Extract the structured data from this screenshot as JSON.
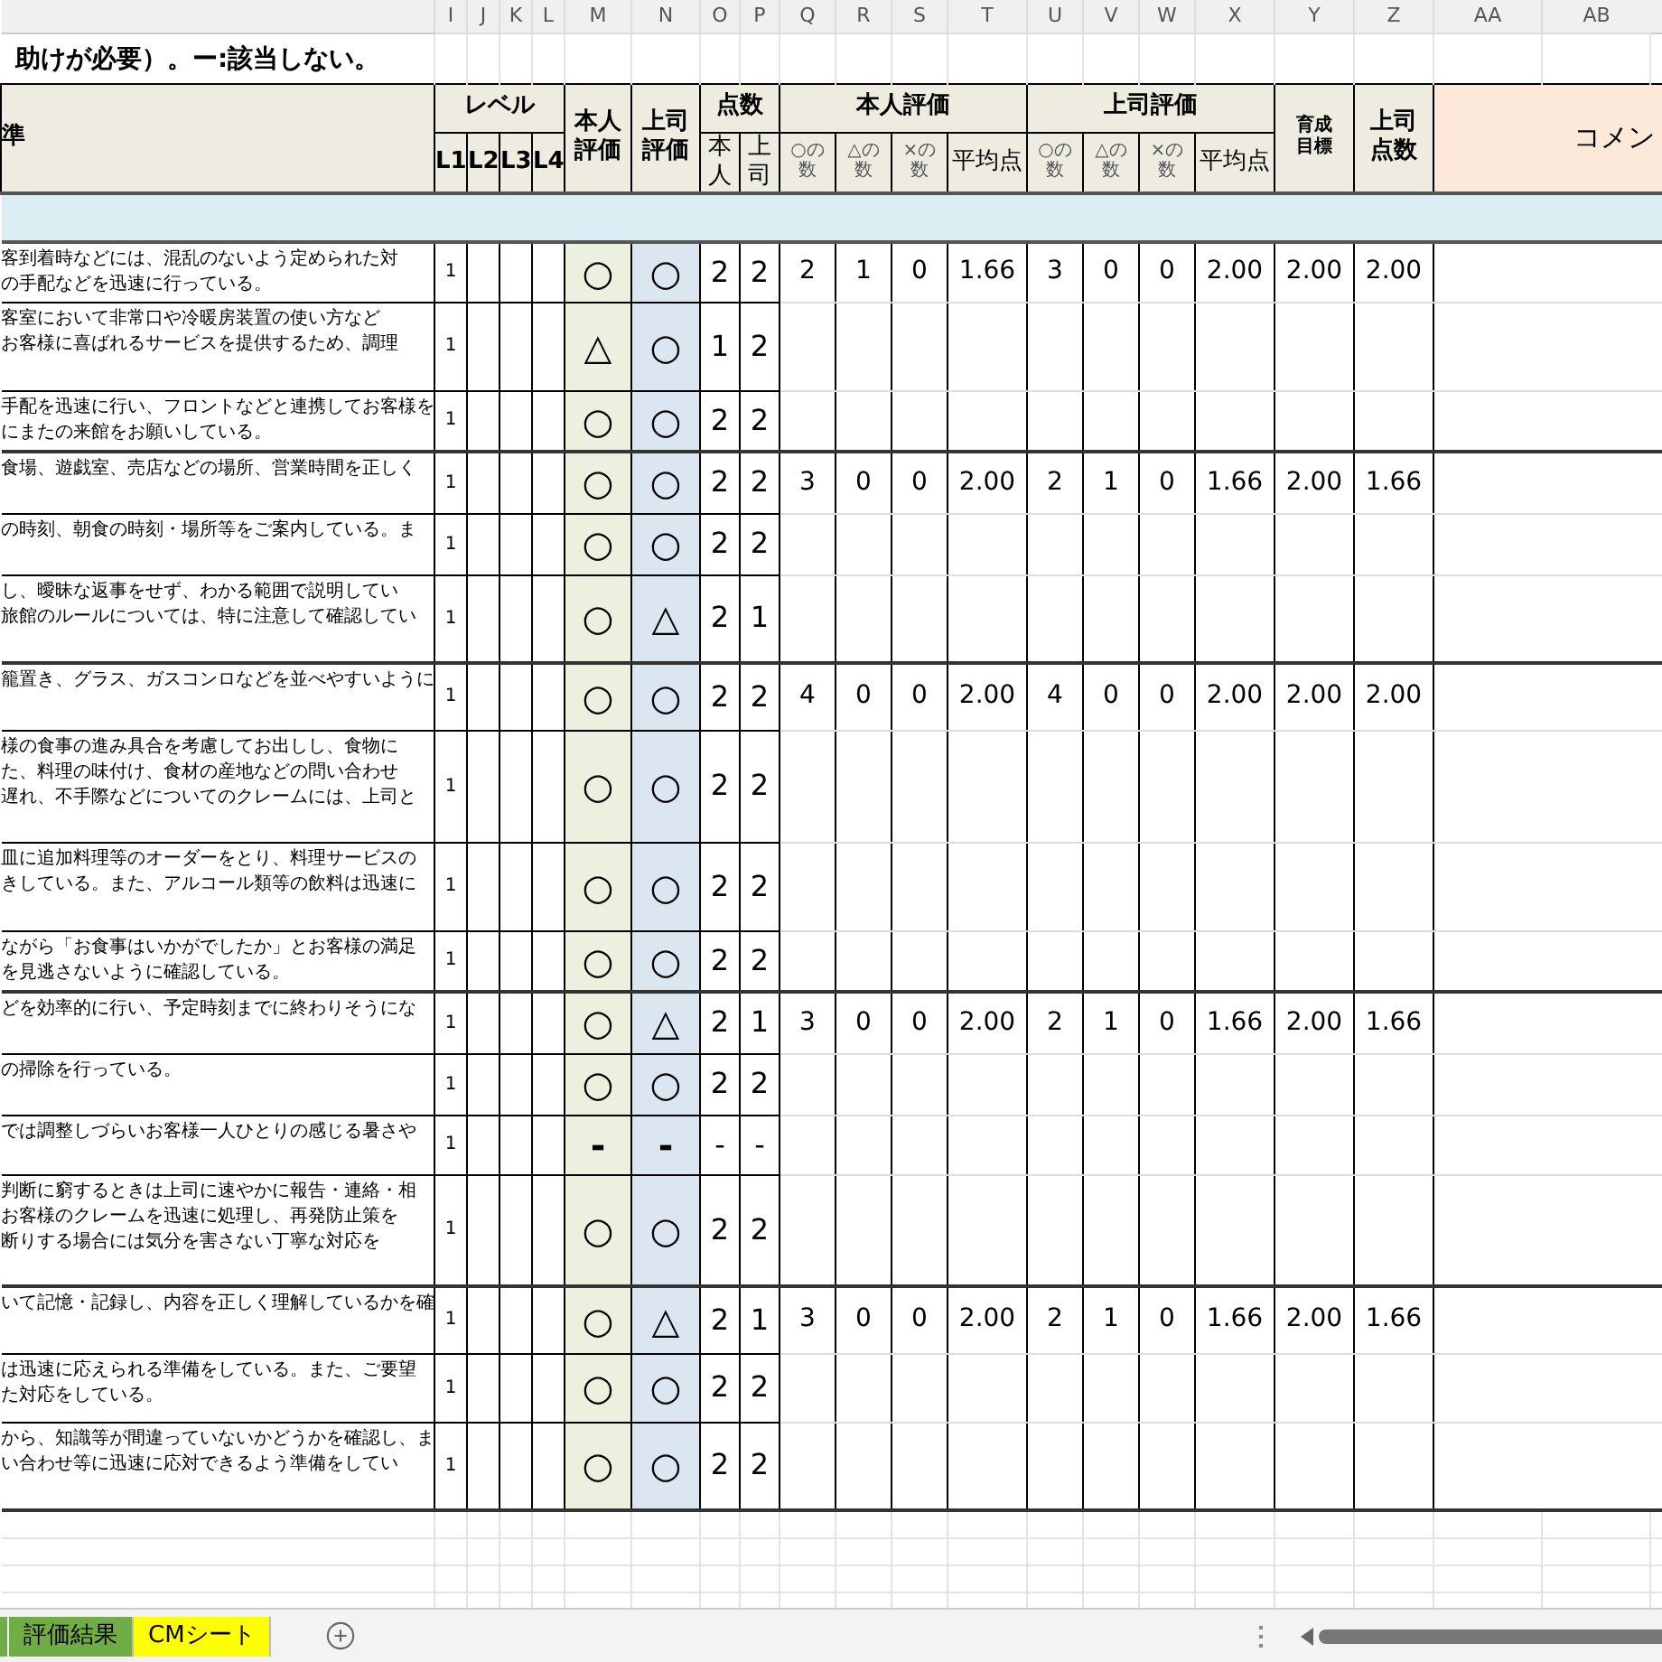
{
  "column_letters": [
    "I",
    "J",
    "K",
    "L",
    "M",
    "N",
    "O",
    "P",
    "Q",
    "R",
    "S",
    "T",
    "U",
    "V",
    "W",
    "X",
    "Y",
    "Z",
    "AA",
    "AB"
  ],
  "title": "助けが必要）。ー:該当しない。",
  "header": {
    "criteria": "準",
    "level": "レベル",
    "levels": [
      "L1",
      "L2",
      "L3",
      "L4"
    ],
    "self_eval": [
      "本人",
      "評価"
    ],
    "boss_eval": [
      "上司",
      "評価"
    ],
    "score": "点数",
    "score_self": [
      "本",
      "人"
    ],
    "score_boss": [
      "上",
      "司"
    ],
    "self_group": "本人評価",
    "boss_group": "上司評価",
    "counts_self": [
      "○の数",
      "△の数",
      "×の数",
      "平均点"
    ],
    "counts_boss": [
      "○の数",
      "△の数",
      "×の数",
      "平均点"
    ],
    "target": "育成目標",
    "boss_score": [
      "上司",
      "点数"
    ],
    "comment": "コメン"
  },
  "groups": [
    {
      "summary": [
        "2",
        "1",
        "0",
        "1.66",
        "3",
        "0",
        "0",
        "2.00",
        "2.00",
        "2.00"
      ],
      "rows": [
        {
          "lines": [
            "客到着時などには、混乱のないよう定められた対",
            "の手配などを迅速に行っている。"
          ],
          "l1": "1",
          "self": "○",
          "boss": "○",
          "score_self": "2",
          "score_boss": "2"
        },
        {
          "lines": [
            "客室において非常口や冷暖房装置の使い方など",
            "お客様に喜ばれるサービスを提供するため、調理"
          ],
          "l1": "1",
          "self": "△",
          "boss": "○",
          "score_self": "1",
          "score_boss": "2"
        },
        {
          "lines": [
            "手配を迅速に行い、フロントなどと連携してお客様を",
            "にまたの来館をお願いしている。"
          ],
          "l1": "1",
          "self": "○",
          "boss": "○",
          "score_self": "2",
          "score_boss": "2"
        }
      ]
    },
    {
      "summary": [
        "3",
        "0",
        "0",
        "2.00",
        "2",
        "1",
        "0",
        "1.66",
        "2.00",
        "1.66"
      ],
      "rows": [
        {
          "lines": [
            "食場、遊戯室、売店などの場所、営業時間を正しく"
          ],
          "l1": "1",
          "self": "○",
          "boss": "○",
          "score_self": "2",
          "score_boss": "2"
        },
        {
          "lines": [
            "の時刻、朝食の時刻・場所等をご案内している。ま"
          ],
          "l1": "1",
          "self": "○",
          "boss": "○",
          "score_self": "2",
          "score_boss": "2"
        },
        {
          "lines": [
            "し、曖昧な返事をせず、わかる範囲で説明してい",
            "旅館のルールについては、特に注意して確認してい"
          ],
          "l1": "1",
          "self": "○",
          "boss": "△",
          "score_self": "2",
          "score_boss": "1"
        }
      ]
    },
    {
      "summary": [
        "4",
        "0",
        "0",
        "2.00",
        "4",
        "0",
        "0",
        "2.00",
        "2.00",
        "2.00"
      ],
      "rows": [
        {
          "lines": [
            "籠置き、グラス、ガスコンロなどを並べやすいように"
          ],
          "l1": "1",
          "self": "○",
          "boss": "○",
          "score_self": "2",
          "score_boss": "2"
        },
        {
          "lines": [
            "様の食事の進み具合を考慮してお出しし、食物に",
            "た、料理の味付け、食材の産地などの問い合わせ",
            "遅れ、不手際などについてのクレームには、上司と"
          ],
          "l1": "1",
          "self": "○",
          "boss": "○",
          "score_self": "2",
          "score_boss": "2"
        },
        {
          "lines": [
            "皿に追加料理等のオーダーをとり、料理サービスの",
            "きしている。また、アルコール類等の飲料は迅速に"
          ],
          "l1": "1",
          "self": "○",
          "boss": "○",
          "score_self": "2",
          "score_boss": "2"
        },
        {
          "lines": [
            "ながら「お食事はいかがでしたか」とお客様の満足",
            "を見逃さないように確認している。"
          ],
          "l1": "1",
          "self": "○",
          "boss": "○",
          "score_self": "2",
          "score_boss": "2"
        }
      ]
    },
    {
      "summary": [
        "3",
        "0",
        "0",
        "2.00",
        "2",
        "1",
        "0",
        "1.66",
        "2.00",
        "1.66"
      ],
      "rows": [
        {
          "lines": [
            "どを効率的に行い、予定時刻までに終わりそうにな"
          ],
          "l1": "1",
          "self": "○",
          "boss": "△",
          "score_self": "2",
          "score_boss": "1"
        },
        {
          "lines": [
            "の掃除を行っている。"
          ],
          "l1": "1",
          "self": "○",
          "boss": "○",
          "score_self": "2",
          "score_boss": "2"
        },
        {
          "lines": [
            "では調整しづらいお客様一人ひとりの感じる暑さや"
          ],
          "l1": "1",
          "self": "-",
          "boss": "-",
          "score_self": "-",
          "score_boss": "-"
        },
        {
          "lines": [
            "判断に窮するときは上司に速やかに報告・連絡・相",
            "お客様のクレームを迅速に処理し、再発防止策を",
            "断りする場合には気分を害さない丁寧な対応を"
          ],
          "l1": "1",
          "self": "○",
          "boss": "○",
          "score_self": "2",
          "score_boss": "2"
        }
      ]
    },
    {
      "summary": [
        "3",
        "0",
        "0",
        "2.00",
        "2",
        "1",
        "0",
        "1.66",
        "2.00",
        "1.66"
      ],
      "rows": [
        {
          "lines": [
            "いて記憶・記録し、内容を正しく理解しているかを確"
          ],
          "l1": "1",
          "self": "○",
          "boss": "△",
          "score_self": "2",
          "score_boss": "1"
        },
        {
          "lines": [
            "は迅速に応えられる準備をしている。また、ご要望",
            "た対応をしている。"
          ],
          "l1": "1",
          "self": "○",
          "boss": "○",
          "score_self": "2",
          "score_boss": "2"
        },
        {
          "lines": [
            "から、知識等が間違っていないかどうかを確認し、ま",
            "い合わせ等に迅速に応対できるよう準備をしてい"
          ],
          "l1": "1",
          "self": "○",
          "boss": "○",
          "score_self": "2",
          "score_boss": "2"
        }
      ]
    }
  ],
  "sheet_tabs": [
    {
      "label": "評価結果",
      "color": "#70ad47",
      "selected": false
    },
    {
      "label": "CMシート",
      "color": "#ffff00",
      "selected": false
    }
  ]
}
